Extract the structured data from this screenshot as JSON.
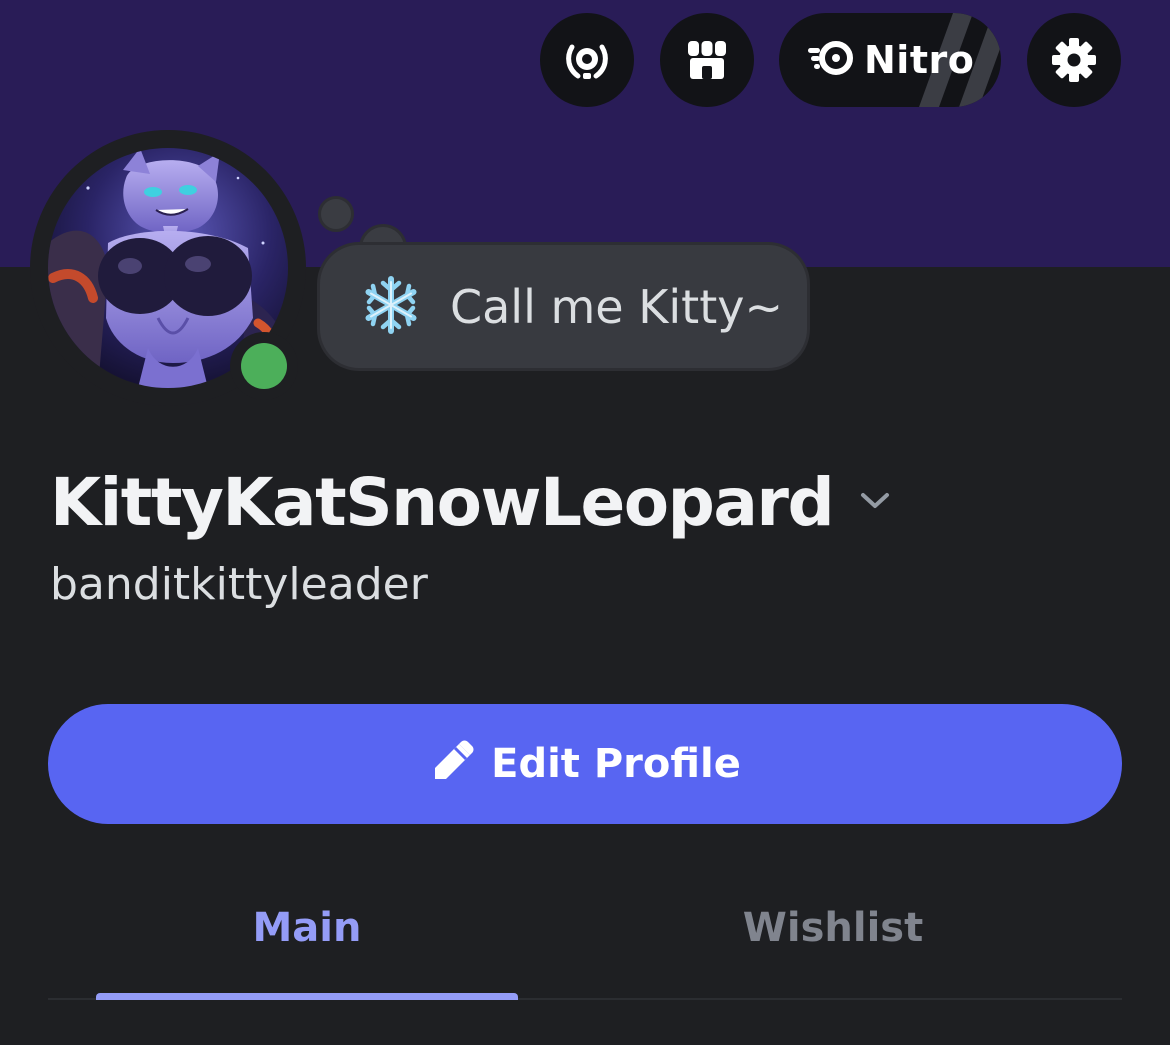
{
  "colors": {
    "banner": "#291c57",
    "background": "#1e1f22",
    "button_dark": "#121317",
    "accent": "#5865f2",
    "tab_active": "#949cf7",
    "tab_inactive": "#80848e",
    "online": "#4caf5a",
    "status_bubble": "#383a40"
  },
  "header": {
    "buttons": [
      {
        "icon": "laurel-badge-icon"
      },
      {
        "icon": "shop-icon"
      },
      {
        "icon": "nitro-icon",
        "label": "Nitro"
      },
      {
        "icon": "gear-icon"
      }
    ]
  },
  "profile": {
    "avatar": "avatar",
    "presence": "online",
    "custom_status": {
      "emoji": "❄️",
      "text": "Call me Kitty~"
    },
    "display_name": "KittyKatSnowLeopard",
    "username": "banditkittyleader"
  },
  "actions": {
    "edit_profile_label": "Edit Profile",
    "edit_icon": "pencil-icon"
  },
  "tabs": [
    {
      "label": "Main",
      "active": true
    },
    {
      "label": "Wishlist",
      "active": false
    }
  ]
}
